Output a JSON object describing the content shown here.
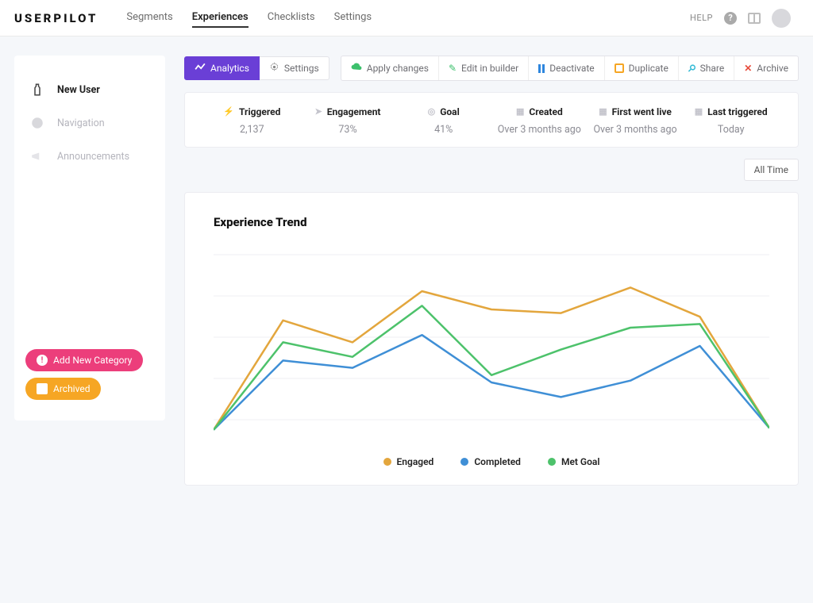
{
  "brand": "USERPILOT",
  "nav": {
    "tabs": [
      "Segments",
      "Experiences",
      "Checklists",
      "Settings"
    ],
    "active_index": 1,
    "help_label": "HELP"
  },
  "sidebar": {
    "items": [
      {
        "label": "New User",
        "active": true
      },
      {
        "label": "Navigation",
        "active": false
      },
      {
        "label": "Announcements",
        "active": false
      }
    ],
    "add_category_label": "Add New Category",
    "archived_label": "Archived"
  },
  "toolbar": {
    "analytics_label": "Analytics",
    "settings_label": "Settings",
    "actions": {
      "apply": "Apply changes",
      "edit": "Edit in builder",
      "deactivate": "Deactivate",
      "duplicate": "Duplicate",
      "share": "Share",
      "archive": "Archive"
    }
  },
  "metrics": [
    {
      "label": "Triggered",
      "value": "2,137"
    },
    {
      "label": "Engagement",
      "value": "73%"
    },
    {
      "label": "Goal",
      "value": "41%"
    },
    {
      "label": "Created",
      "value": "Over 3 months ago"
    },
    {
      "label": "First went live",
      "value": "Over 3 months ago"
    },
    {
      "label": "Last triggered",
      "value": "Today"
    }
  ],
  "filter": {
    "range_label": "All Time"
  },
  "chart": {
    "title": "Experience Trend",
    "legend": [
      "Engaged",
      "Completed",
      "Met Goal"
    ],
    "colors": {
      "engaged": "#e3a63d",
      "completed": "#3f8fd6",
      "metgoal": "#4dc26b"
    }
  },
  "chart_data": {
    "type": "line",
    "title": "Experience Trend",
    "x": [
      0,
      1,
      2,
      3,
      4,
      5,
      6,
      7,
      8
    ],
    "ylim": [
      0,
      100
    ],
    "series": [
      {
        "name": "Engaged",
        "color": "#e3a63d",
        "values": [
          4,
          64,
          52,
          80,
          70,
          68,
          82,
          66,
          5
        ]
      },
      {
        "name": "Completed",
        "color": "#3f8fd6",
        "values": [
          4,
          42,
          38,
          56,
          30,
          22,
          31,
          50,
          5
        ]
      },
      {
        "name": "Met Goal",
        "color": "#4dc26b",
        "values": [
          4,
          52,
          44,
          72,
          34,
          48,
          60,
          62,
          5
        ]
      }
    ]
  }
}
